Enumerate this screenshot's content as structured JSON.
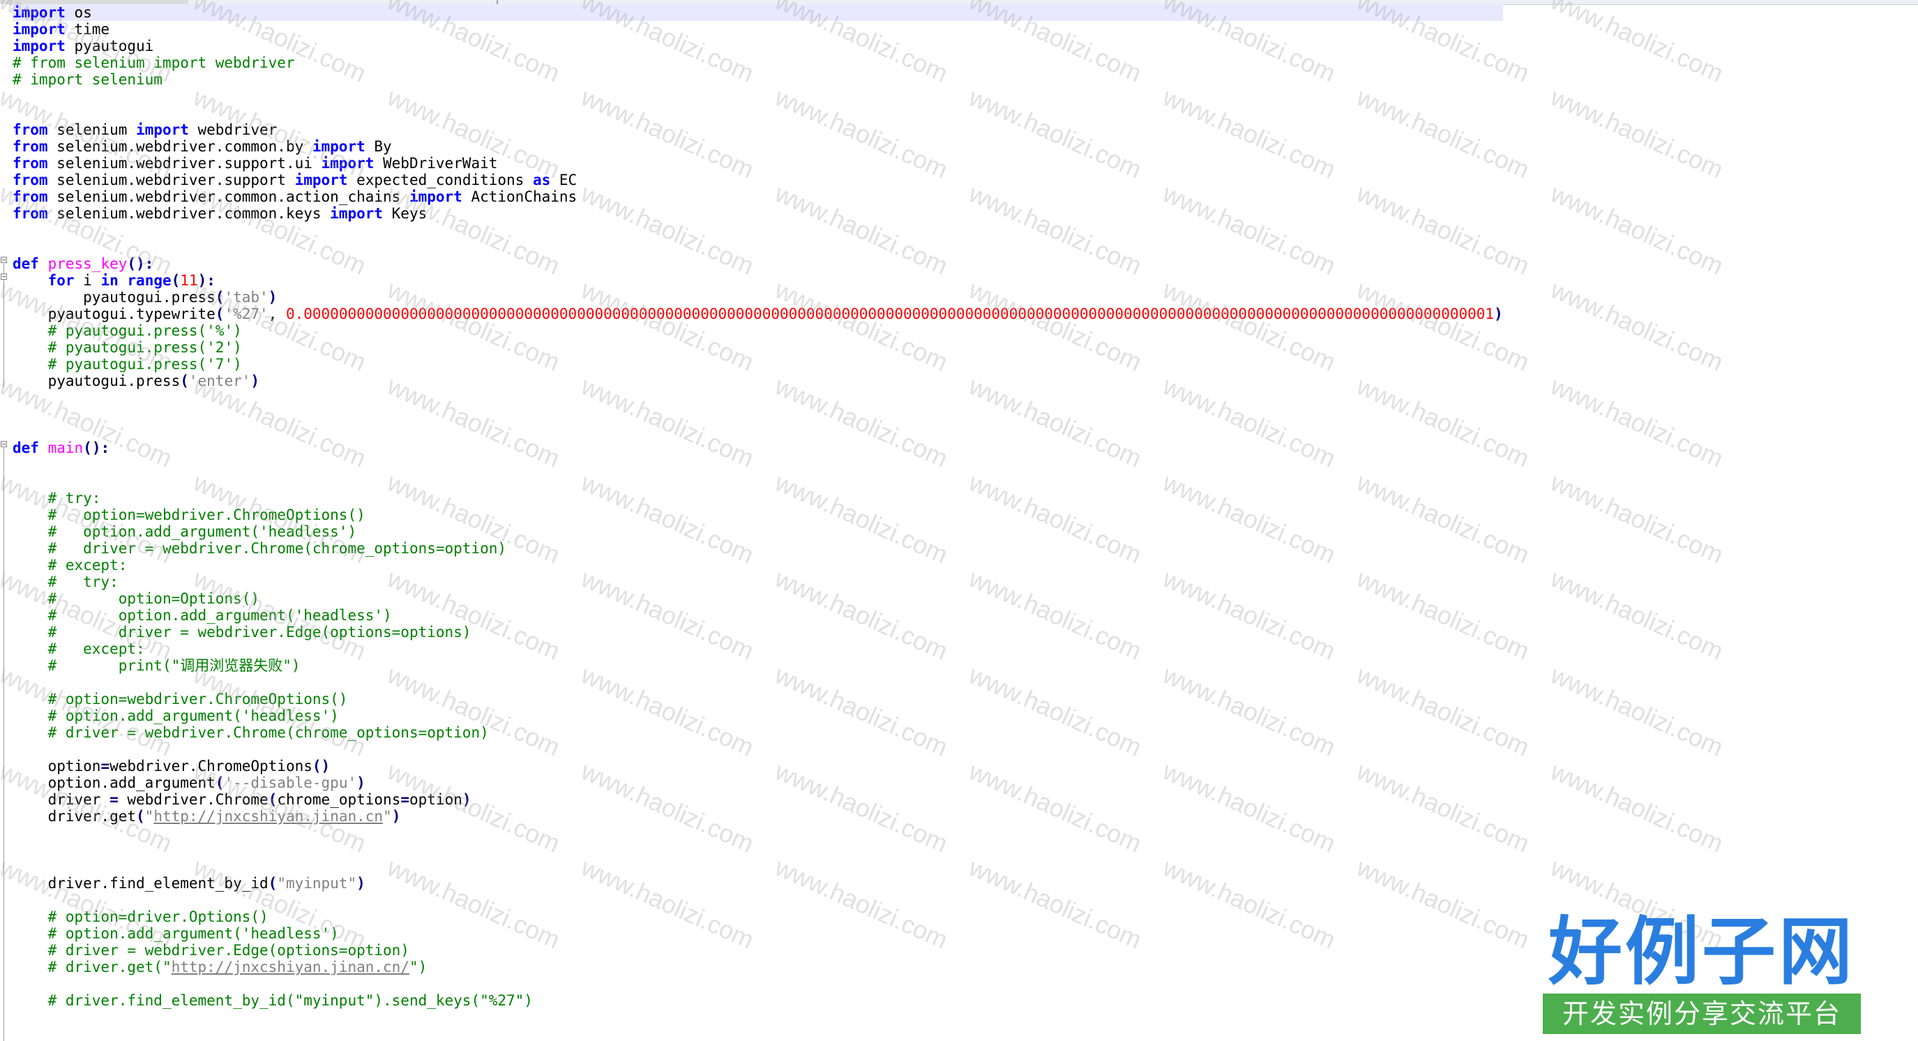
{
  "editor": {
    "tabs": [
      "",
      ""
    ],
    "lines": [
      [
        {
          "k": "kw",
          "t": "import"
        },
        {
          "k": "plain",
          "t": " os"
        }
      ],
      [
        {
          "k": "kw",
          "t": "import"
        },
        {
          "k": "plain",
          "t": " time"
        }
      ],
      [
        {
          "k": "kw",
          "t": "import"
        },
        {
          "k": "plain",
          "t": " pyautogui"
        }
      ],
      [
        {
          "k": "com",
          "t": "# from selenium import webdriver"
        }
      ],
      [
        {
          "k": "com",
          "t": "# import selenium"
        }
      ],
      [],
      [],
      [
        {
          "k": "kw",
          "t": "from"
        },
        {
          "k": "plain",
          "t": " selenium "
        },
        {
          "k": "kw",
          "t": "import"
        },
        {
          "k": "plain",
          "t": " webdriver"
        }
      ],
      [
        {
          "k": "kw",
          "t": "from"
        },
        {
          "k": "plain",
          "t": " selenium.webdriver.common.by "
        },
        {
          "k": "kw",
          "t": "import"
        },
        {
          "k": "plain",
          "t": " By"
        }
      ],
      [
        {
          "k": "kw",
          "t": "from"
        },
        {
          "k": "plain",
          "t": " selenium.webdriver.support.ui "
        },
        {
          "k": "kw",
          "t": "import"
        },
        {
          "k": "plain",
          "t": " WebDriverWait"
        }
      ],
      [
        {
          "k": "kw",
          "t": "from"
        },
        {
          "k": "plain",
          "t": " selenium.webdriver.support "
        },
        {
          "k": "kw",
          "t": "import"
        },
        {
          "k": "plain",
          "t": " expected_conditions "
        },
        {
          "k": "kw",
          "t": "as"
        },
        {
          "k": "plain",
          "t": " EC"
        }
      ],
      [
        {
          "k": "kw",
          "t": "from"
        },
        {
          "k": "plain",
          "t": " selenium.webdriver.common.action_chains "
        },
        {
          "k": "kw",
          "t": "import"
        },
        {
          "k": "plain",
          "t": " ActionChains"
        }
      ],
      [
        {
          "k": "kw",
          "t": "from"
        },
        {
          "k": "plain",
          "t": " selenium.webdriver.common.keys "
        },
        {
          "k": "kw",
          "t": "import"
        },
        {
          "k": "plain",
          "t": " Keys"
        }
      ],
      [],
      [],
      [
        {
          "k": "kw",
          "t": "def"
        },
        {
          "k": "plain",
          "t": " "
        },
        {
          "k": "fn",
          "t": "press_key"
        },
        {
          "k": "op",
          "t": "():"
        }
      ],
      [
        {
          "k": "plain",
          "t": "    "
        },
        {
          "k": "kw",
          "t": "for"
        },
        {
          "k": "plain",
          "t": " i "
        },
        {
          "k": "kw",
          "t": "in"
        },
        {
          "k": "plain",
          "t": " "
        },
        {
          "k": "kw",
          "t": "range"
        },
        {
          "k": "op",
          "t": "("
        },
        {
          "k": "num",
          "t": "11"
        },
        {
          "k": "op",
          "t": "):"
        }
      ],
      [
        {
          "k": "plain",
          "t": "        pyautogui.press"
        },
        {
          "k": "op",
          "t": "("
        },
        {
          "k": "str",
          "t": "'tab'"
        },
        {
          "k": "op",
          "t": ")"
        }
      ],
      [
        {
          "k": "plain",
          "t": "    pyautogui.typewrite"
        },
        {
          "k": "op",
          "t": "("
        },
        {
          "k": "str",
          "t": "'%27'"
        },
        {
          "k": "plain",
          "t": ", "
        },
        {
          "k": "num",
          "t": "0.000000000000000000000000000000000000000000000000000000000000000000000000000000000000000000000000000000000000000000000000000000000000001"
        },
        {
          "k": "op",
          "t": ")"
        }
      ],
      [
        {
          "k": "plain",
          "t": "    "
        },
        {
          "k": "com",
          "t": "# pyautogui.press('%')"
        }
      ],
      [
        {
          "k": "plain",
          "t": "    "
        },
        {
          "k": "com",
          "t": "# pyautogui.press('2')"
        }
      ],
      [
        {
          "k": "plain",
          "t": "    "
        },
        {
          "k": "com",
          "t": "# pyautogui.press('7')"
        }
      ],
      [
        {
          "k": "plain",
          "t": "    pyautogui.press"
        },
        {
          "k": "op",
          "t": "("
        },
        {
          "k": "str",
          "t": "'enter'"
        },
        {
          "k": "op",
          "t": ")"
        }
      ],
      [],
      [],
      [],
      [
        {
          "k": "kw",
          "t": "def"
        },
        {
          "k": "plain",
          "t": " "
        },
        {
          "k": "fn",
          "t": "main"
        },
        {
          "k": "op",
          "t": "():"
        }
      ],
      [],
      [],
      [
        {
          "k": "plain",
          "t": "    "
        },
        {
          "k": "com",
          "t": "# try:"
        }
      ],
      [
        {
          "k": "plain",
          "t": "    "
        },
        {
          "k": "com",
          "t": "#   option=webdriver.ChromeOptions()"
        }
      ],
      [
        {
          "k": "plain",
          "t": "    "
        },
        {
          "k": "com",
          "t": "#   option.add_argument('headless')"
        }
      ],
      [
        {
          "k": "plain",
          "t": "    "
        },
        {
          "k": "com",
          "t": "#   driver = webdriver.Chrome(chrome_options=option)"
        }
      ],
      [
        {
          "k": "plain",
          "t": "    "
        },
        {
          "k": "com",
          "t": "# except:"
        }
      ],
      [
        {
          "k": "plain",
          "t": "    "
        },
        {
          "k": "com",
          "t": "#   try:"
        }
      ],
      [
        {
          "k": "plain",
          "t": "    "
        },
        {
          "k": "com",
          "t": "#       option=Options()"
        }
      ],
      [
        {
          "k": "plain",
          "t": "    "
        },
        {
          "k": "com",
          "t": "#       option.add_argument('headless')"
        }
      ],
      [
        {
          "k": "plain",
          "t": "    "
        },
        {
          "k": "com",
          "t": "#       driver = webdriver.Edge(options=options)"
        }
      ],
      [
        {
          "k": "plain",
          "t": "    "
        },
        {
          "k": "com",
          "t": "#   except:"
        }
      ],
      [
        {
          "k": "plain",
          "t": "    "
        },
        {
          "k": "com",
          "t": "#       print(\"调用浏览器失败\")"
        }
      ],
      [],
      [
        {
          "k": "plain",
          "t": "    "
        },
        {
          "k": "com",
          "t": "# option=webdriver.ChromeOptions()"
        }
      ],
      [
        {
          "k": "plain",
          "t": "    "
        },
        {
          "k": "com",
          "t": "# option.add_argument('headless')"
        }
      ],
      [
        {
          "k": "plain",
          "t": "    "
        },
        {
          "k": "com",
          "t": "# driver = webdriver.Chrome(chrome_options=option)"
        }
      ],
      [],
      [
        {
          "k": "plain",
          "t": "    option"
        },
        {
          "k": "op",
          "t": "="
        },
        {
          "k": "plain",
          "t": "webdriver.ChromeOptions"
        },
        {
          "k": "op",
          "t": "()"
        }
      ],
      [
        {
          "k": "plain",
          "t": "    option.add_argument"
        },
        {
          "k": "op",
          "t": "("
        },
        {
          "k": "str",
          "t": "'--disable-gpu'"
        },
        {
          "k": "op",
          "t": ")"
        }
      ],
      [
        {
          "k": "plain",
          "t": "    driver "
        },
        {
          "k": "op",
          "t": "="
        },
        {
          "k": "plain",
          "t": " webdriver.Chrome"
        },
        {
          "k": "op",
          "t": "("
        },
        {
          "k": "plain",
          "t": "chrome_options"
        },
        {
          "k": "op",
          "t": "="
        },
        {
          "k": "plain",
          "t": "option"
        },
        {
          "k": "op",
          "t": ")"
        }
      ],
      [
        {
          "k": "plain",
          "t": "    driver.get"
        },
        {
          "k": "op",
          "t": "("
        },
        {
          "k": "str",
          "t": "\""
        },
        {
          "k": "link",
          "t": "http://jnxcshiyan.jinan.cn"
        },
        {
          "k": "str",
          "t": "\""
        },
        {
          "k": "op",
          "t": ")"
        }
      ],
      [],
      [],
      [],
      [
        {
          "k": "plain",
          "t": "    driver.find_element_by_id"
        },
        {
          "k": "op",
          "t": "("
        },
        {
          "k": "str",
          "t": "\"myinput\""
        },
        {
          "k": "op",
          "t": ")"
        }
      ],
      [],
      [
        {
          "k": "plain",
          "t": "    "
        },
        {
          "k": "com",
          "t": "# option=driver.Options()"
        }
      ],
      [
        {
          "k": "plain",
          "t": "    "
        },
        {
          "k": "com",
          "t": "# option.add_argument('headless')"
        }
      ],
      [
        {
          "k": "plain",
          "t": "    "
        },
        {
          "k": "com",
          "t": "# driver = webdriver.Edge(options=option)"
        }
      ],
      [
        {
          "k": "plain",
          "t": "    "
        },
        {
          "k": "com",
          "t": "# driver.get(\""
        },
        {
          "k": "link",
          "t": "http://jnxcshiyan.jinan.cn/"
        },
        {
          "k": "com",
          "t": "\")"
        }
      ],
      [],
      [
        {
          "k": "plain",
          "t": "    "
        },
        {
          "k": "com",
          "t": "# driver.find_element_by_id(\"myinput\").send_keys(\"%27\")"
        }
      ],
      [],
      []
    ]
  },
  "watermark": {
    "text": "www.haolizi.com"
  },
  "logo": {
    "title": "好例子网",
    "subtitle": "开发实例分享交流平台",
    "title_color": "#2a7ee0",
    "subtitle_bg": "#4cae4c"
  },
  "colors": {
    "keyword": "#0000ff",
    "function": "#ff00ff",
    "comment": "#008000",
    "string": "#808080",
    "number": "#ff0000"
  }
}
